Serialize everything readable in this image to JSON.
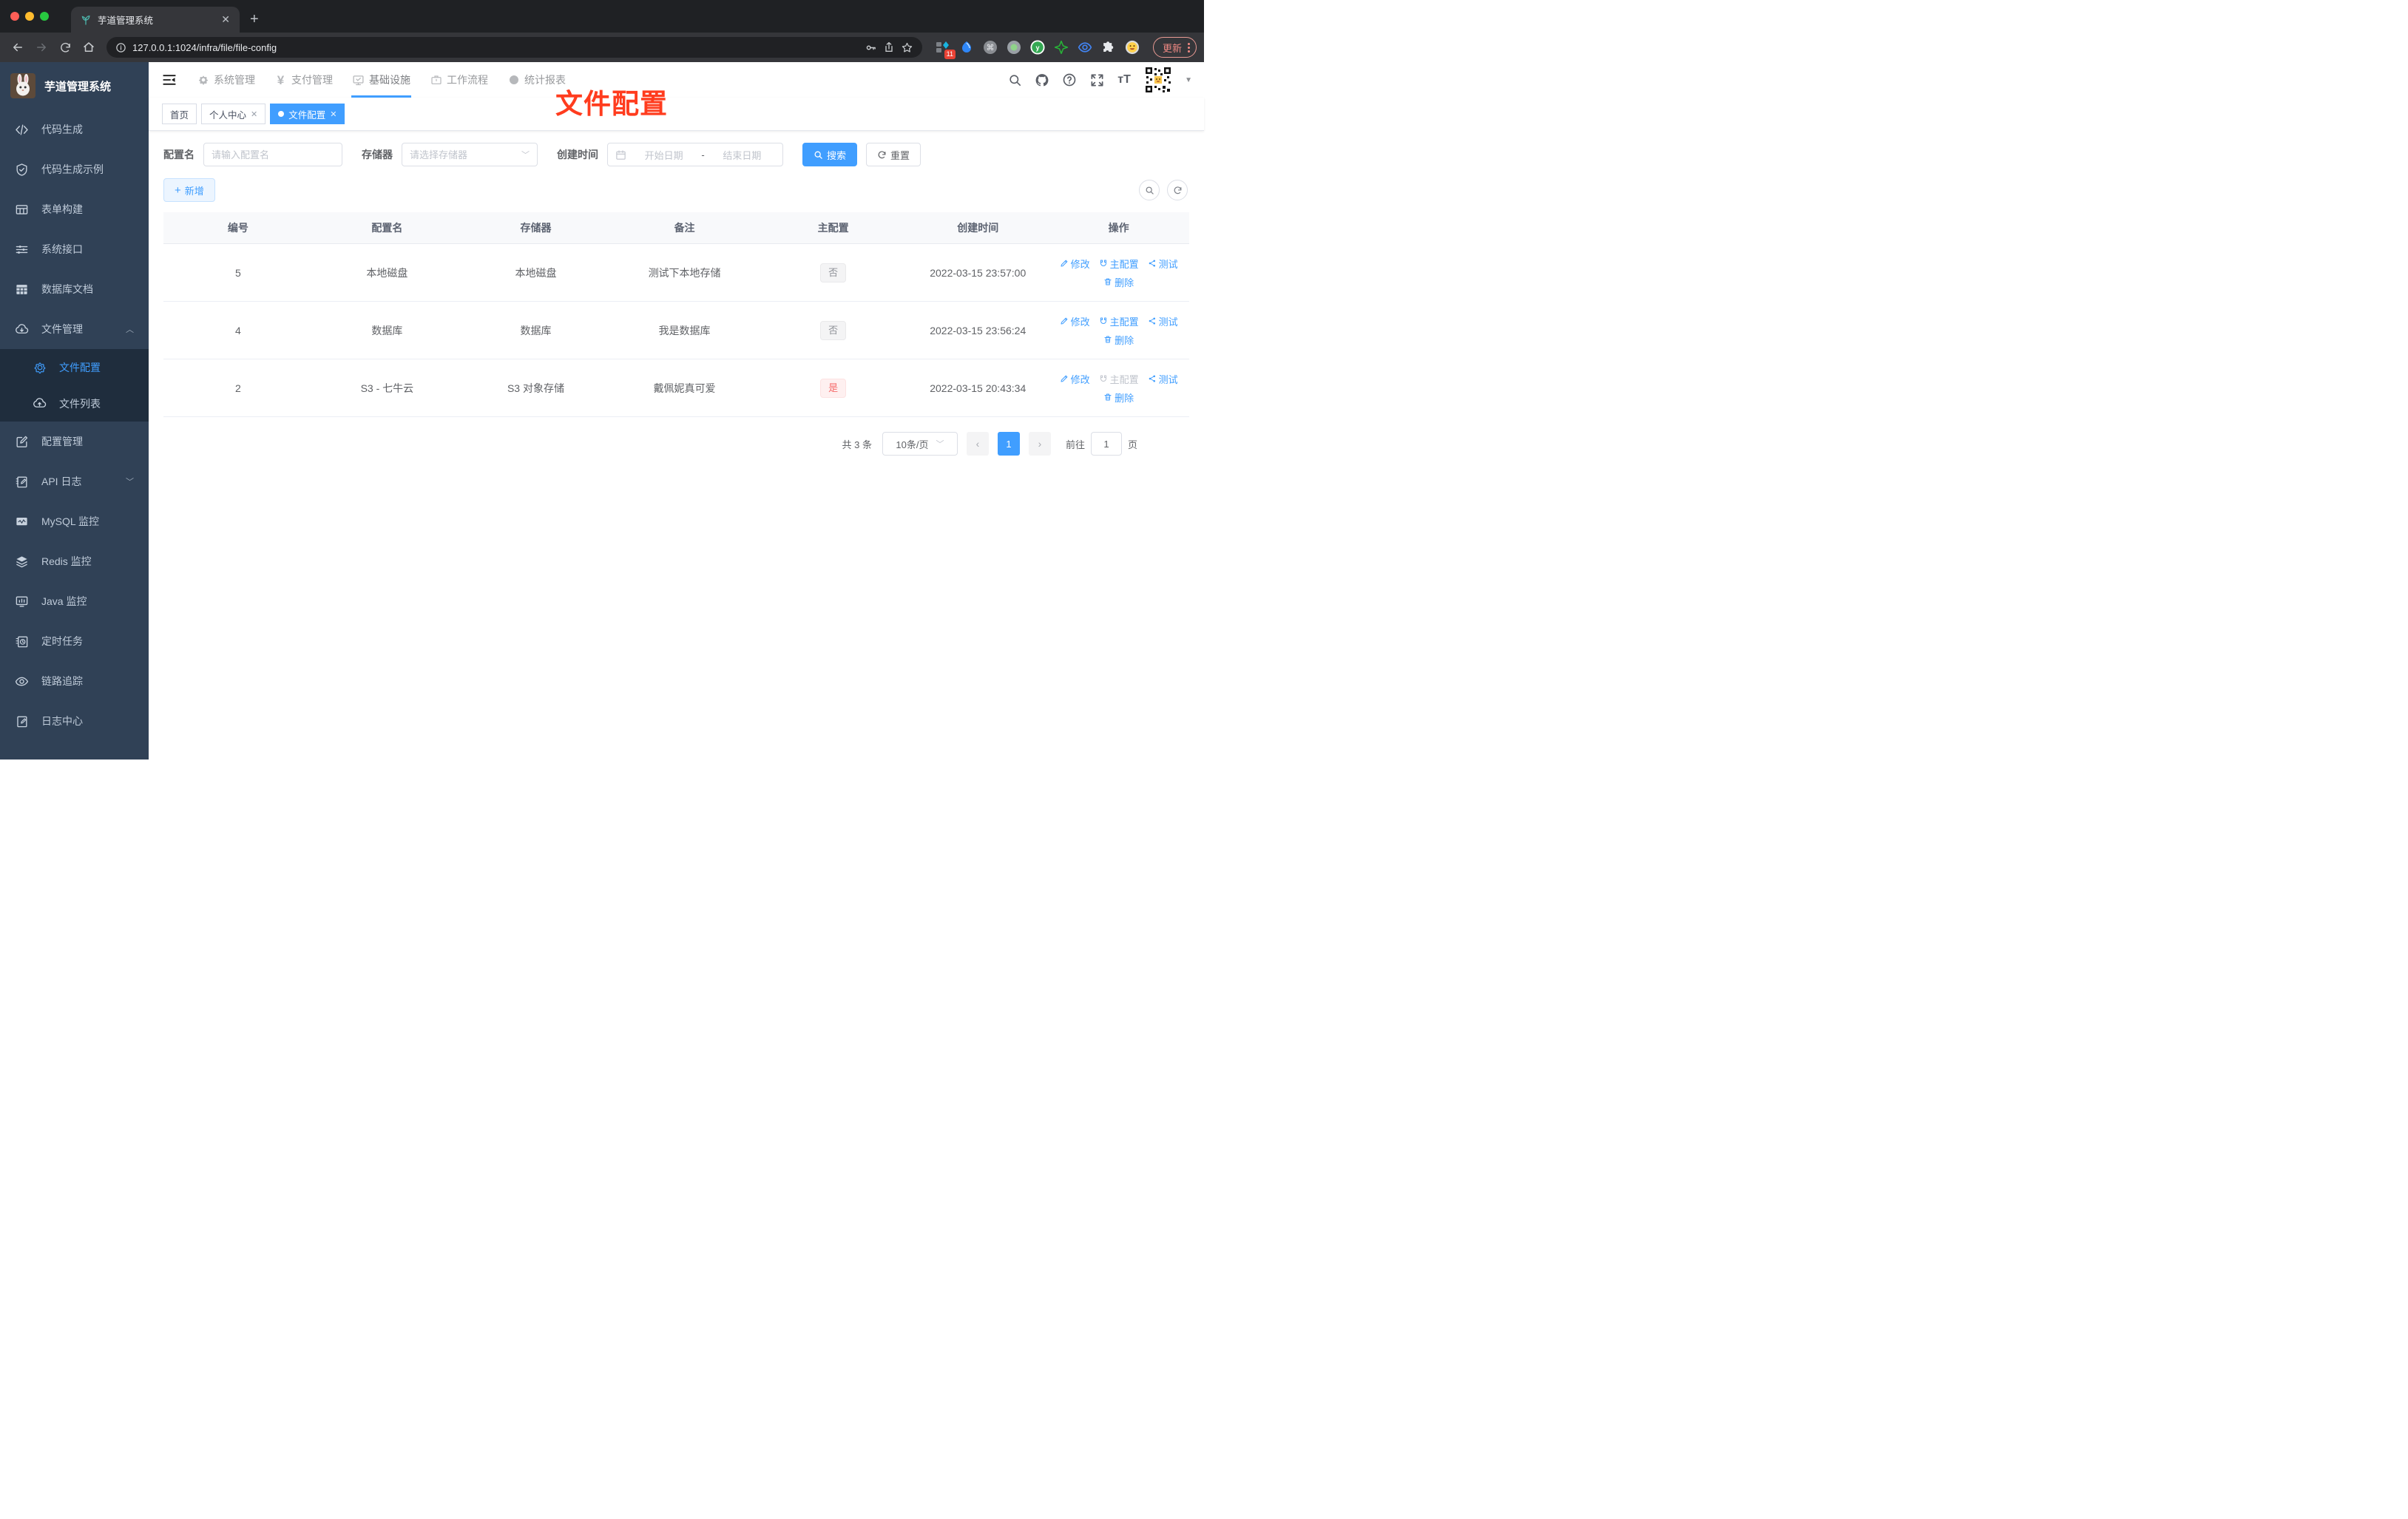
{
  "browser": {
    "tab_title": "芋道管理系统",
    "url": "127.0.0.1:1024/infra/file/file-config",
    "update_label": "更新",
    "extension_badge": "11"
  },
  "sidebar": {
    "title": "芋道管理系统",
    "items": [
      {
        "label": "代码生成"
      },
      {
        "label": "代码生成示例"
      },
      {
        "label": "表单构建"
      },
      {
        "label": "系统接口"
      },
      {
        "label": "数据库文档"
      },
      {
        "label": "文件管理"
      },
      {
        "label": "文件配置"
      },
      {
        "label": "文件列表"
      },
      {
        "label": "配置管理"
      },
      {
        "label": "API 日志"
      },
      {
        "label": "MySQL 监控"
      },
      {
        "label": "Redis 监控"
      },
      {
        "label": "Java 监控"
      },
      {
        "label": "定时任务"
      },
      {
        "label": "链路追踪"
      },
      {
        "label": "日志中心"
      }
    ]
  },
  "nav": {
    "items": [
      {
        "label": "系统管理"
      },
      {
        "label": "支付管理"
      },
      {
        "label": "基础设施"
      },
      {
        "label": "工作流程"
      },
      {
        "label": "统计报表"
      }
    ]
  },
  "tags": {
    "items": [
      {
        "label": "首页"
      },
      {
        "label": "个人中心"
      },
      {
        "label": "文件配置"
      }
    ]
  },
  "annotation": {
    "text": "文件配置"
  },
  "filter": {
    "name_label": "配置名",
    "name_placeholder": "请输入配置名",
    "storage_label": "存储器",
    "storage_placeholder": "请选择存储器",
    "date_label": "创建时间",
    "date_start_placeholder": "开始日期",
    "date_separator": "-",
    "date_end_placeholder": "结束日期",
    "search_label": "搜索",
    "reset_label": "重置"
  },
  "toolbar": {
    "add_label": "新增"
  },
  "table": {
    "headers": [
      "编号",
      "配置名",
      "存储器",
      "备注",
      "主配置",
      "创建时间",
      "操作"
    ],
    "action_labels": {
      "edit": "修改",
      "master": "主配置",
      "test": "测试",
      "delete": "删除"
    },
    "rows": [
      {
        "id": "5",
        "name": "本地磁盘",
        "storage": "本地磁盘",
        "remark": "测试下本地存储",
        "master": "否",
        "master_type": "info",
        "created": "2022-03-15 23:57:00"
      },
      {
        "id": "4",
        "name": "数据库",
        "storage": "数据库",
        "remark": "我是数据库",
        "master": "否",
        "master_type": "info",
        "created": "2022-03-15 23:56:24"
      },
      {
        "id": "2",
        "name": "S3 - 七牛云",
        "storage": "S3 对象存储",
        "remark": "戴佩妮真可爱",
        "master": "是",
        "master_type": "danger",
        "created": "2022-03-15 20:43:34"
      }
    ]
  },
  "pagination": {
    "total": "共 3 条",
    "page_size": "10条/页",
    "current_page": "1",
    "goto_label": "前往",
    "goto_value": "1",
    "page_suffix": "页"
  },
  "colors": {
    "primary": "#409eff",
    "danger": "#f56c6c",
    "sidebar_bg": "#304156",
    "submenu_bg": "#1f2d3d",
    "annotation": "#ff3c1e"
  }
}
